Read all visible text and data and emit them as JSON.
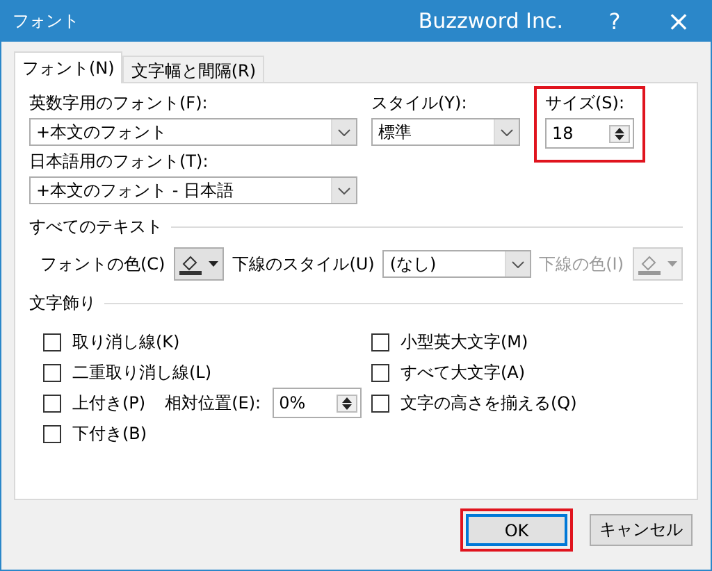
{
  "window": {
    "title": "フォント",
    "brand": "Buzzword Inc.",
    "help": "?",
    "close": "×"
  },
  "tabs": [
    {
      "label": "フォント(N)",
      "selected": true
    },
    {
      "label": "文字幅と間隔(R)",
      "selected": false
    }
  ],
  "latin_font": {
    "label": "英数字用のフォント(F):",
    "value": "+本文のフォント"
  },
  "style": {
    "label": "スタイル(Y):",
    "value": "標準"
  },
  "size": {
    "label": "サイズ(S):",
    "value": "18",
    "highlighted": true
  },
  "japanese_font": {
    "label": "日本語用のフォント(T):",
    "value": "+本文のフォント - 日本語"
  },
  "all_text": {
    "heading": "すべてのテキスト",
    "font_color": {
      "label": "フォントの色(C)",
      "disabled": false
    },
    "underline_style": {
      "label": "下線のスタイル(U)",
      "value": "(なし)"
    },
    "underline_color": {
      "label": "下線の色(I)",
      "disabled": true
    }
  },
  "effects": {
    "heading": "文字飾り",
    "left_options": [
      {
        "label": "取り消し線(K)",
        "checked": false
      },
      {
        "label": "二重取り消し線(L)",
        "checked": false
      },
      {
        "label": "上付き(P)",
        "checked": false,
        "offset": {
          "label": "相対位置(E):",
          "value": "0%"
        }
      },
      {
        "label": "下付き(B)",
        "checked": false
      }
    ],
    "right_options": [
      {
        "label": "小型英大文字(M)",
        "checked": false
      },
      {
        "label": "すべて大文字(A)",
        "checked": false
      },
      {
        "label": "文字の高さを揃える(Q)",
        "checked": false
      }
    ]
  },
  "buttons": [
    {
      "label": "OK",
      "default": true,
      "highlighted": true
    },
    {
      "label": "キャンセル",
      "default": false,
      "highlighted": false
    }
  ]
}
